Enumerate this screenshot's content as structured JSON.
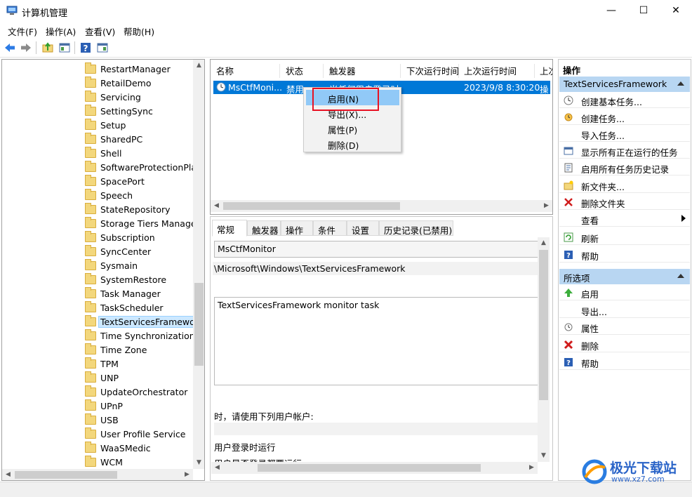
{
  "window": {
    "title": "计算机管理",
    "minimize": "—",
    "maximize": "☐",
    "close": "✕"
  },
  "menu": [
    "文件(F)",
    "操作(A)",
    "查看(V)",
    "帮助(H)"
  ],
  "toolbar": {
    "icons": [
      "back-arrow-icon",
      "forward-arrow-icon",
      "up-folder-icon",
      "show-hide-tree-icon",
      "help-icon",
      "properties-icon"
    ]
  },
  "tree": {
    "items": [
      "RestartManager",
      "RetailDemo",
      "Servicing",
      "SettingSync",
      "Setup",
      "SharedPC",
      "Shell",
      "SoftwareProtectionPlat",
      "SpacePort",
      "Speech",
      "StateRepository",
      "Storage Tiers Manager",
      "Subscription",
      "SyncCenter",
      "Sysmain",
      "SystemRestore",
      "Task Manager",
      "TaskScheduler",
      "TextServicesFramework",
      "Time Synchronization",
      "Time Zone",
      "TPM",
      "UNP",
      "UpdateOrchestrator",
      "UPnP",
      "USB",
      "User Profile Service",
      "WaaSMedic",
      "WCM"
    ],
    "selected_index": 18
  },
  "task_list": {
    "columns": [
      "名称",
      "状态",
      "触发器",
      "下次运行时间",
      "上次运行时间",
      "上次"
    ],
    "row": {
      "name": "MsCtfMoni...",
      "status": "禁用",
      "trigger": "当任何用户登录时",
      "next_run": "",
      "last_run": "2023/9/8 8:30:20",
      "last_result": "操"
    }
  },
  "context_menu": {
    "items": [
      "启用(N)",
      "导出(X)...",
      "属性(P)",
      "删除(D)"
    ],
    "highlighted_index": 0
  },
  "detail": {
    "tabs": [
      "常规",
      "触发器",
      "操作",
      "条件",
      "设置",
      "历史记录(已禁用)"
    ],
    "active_tab": 0,
    "name_value": "MsCtfMonitor",
    "location": "\\Microsoft\\Windows\\TextServicesFramework",
    "description": "TextServicesFramework monitor task",
    "security_label": "时，请使用下列用户帐户:",
    "run_option_1": "用户登录时运行",
    "run_option_2": "用户是否登录都要运行"
  },
  "actions": {
    "header": "操作",
    "section1": "TextServicesFramework",
    "items1": [
      "创建基本任务...",
      "创建任务...",
      "导入任务...",
      "显示所有正在运行的任务",
      "启用所有任务历史记录",
      "新文件夹...",
      "删除文件夹",
      "查看",
      "刷新",
      "帮助"
    ],
    "section2": "所选项",
    "items2": [
      "启用",
      "导出...",
      "属性",
      "删除",
      "帮助"
    ]
  },
  "watermark": {
    "text": "极光下载站",
    "url": "www.xz7.com"
  },
  "colors": {
    "selection": "#0078d7",
    "menu_highlight": "#91c9f7",
    "section": "#b8d6f2",
    "annotation_box": "#e81123"
  }
}
